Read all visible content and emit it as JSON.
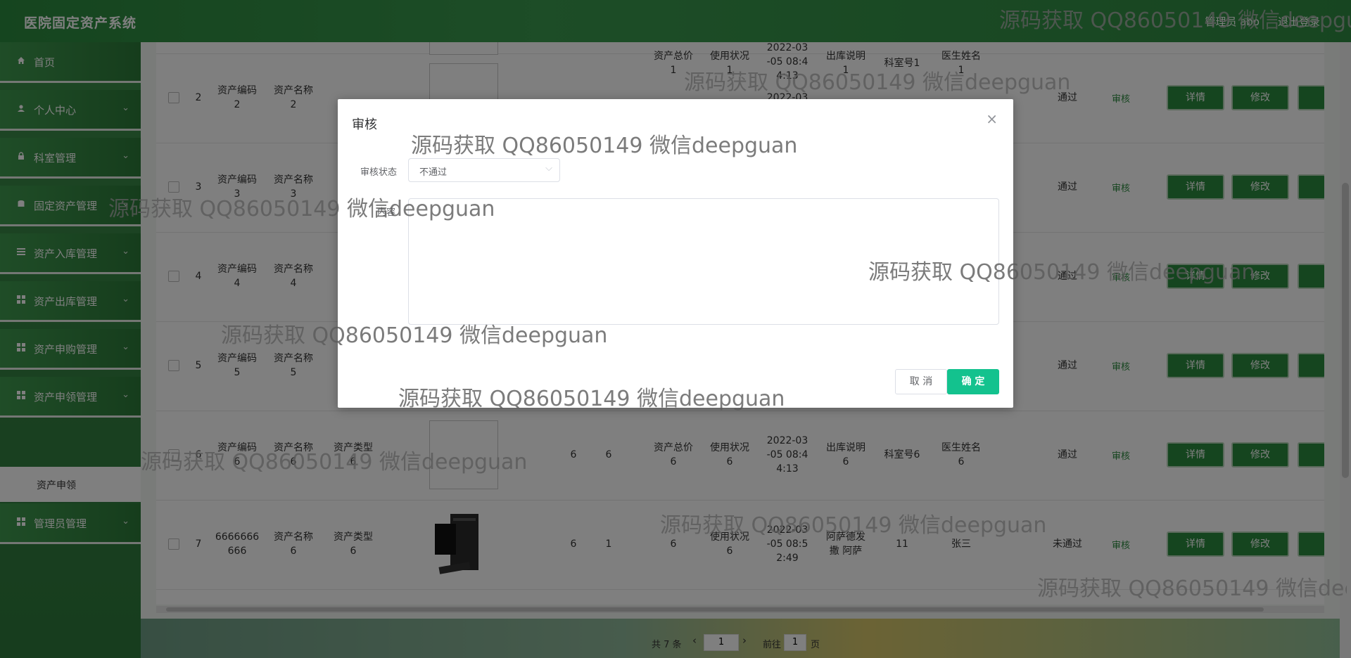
{
  "app": {
    "title": "医院固定资产系统",
    "user": "管理员 abo",
    "logout": "退出登录"
  },
  "sidebar": {
    "items": [
      {
        "label": "首页",
        "icon": "home-icon",
        "chevron": ""
      },
      {
        "label": "个人中心",
        "icon": "user-icon",
        "chevron": "⌄"
      },
      {
        "label": "科室管理",
        "icon": "lock-icon",
        "chevron": "⌄"
      },
      {
        "label": "固定资产管理",
        "icon": "database-icon",
        "chevron": "⌄"
      },
      {
        "label": "资产入库管理",
        "icon": "list-icon",
        "chevron": "⌄"
      },
      {
        "label": "资产出库管理",
        "icon": "grid-icon",
        "chevron": "⌄"
      },
      {
        "label": "资产申购管理",
        "icon": "grid-icon",
        "chevron": "⌄"
      },
      {
        "label": "资产申领管理",
        "icon": "grid-icon",
        "chevron": "⌄"
      },
      {
        "label": "管理员管理",
        "icon": "grid-icon",
        "chevron": "⌄"
      }
    ],
    "sub_item": "资产申领"
  },
  "table": {
    "partial_top_row": {
      "col1": "资产总价\n1",
      "col2": "使用状况\n1",
      "date": "2022-03\n-05 08:4\n4:13",
      "desc": "出库说明\n1",
      "dept": "科室号1",
      "doctor": "医生姓名\n1"
    },
    "rows": [
      {
        "idx": "2",
        "code": "资产编码\n2",
        "name": "资产名称\n2",
        "type": "",
        "qty": "",
        "num": "",
        "total": "",
        "status": "",
        "date": "2022-03",
        "desc": "",
        "dept": "",
        "doctor": "",
        "audit": "通过"
      },
      {
        "idx": "3",
        "code": "资产编码\n3",
        "name": "资产名称\n3",
        "type": "",
        "qty": "",
        "num": "",
        "total": "",
        "status": "",
        "date": "",
        "desc": "",
        "dept": "",
        "doctor": "",
        "audit": "通过"
      },
      {
        "idx": "4",
        "code": "资产编码\n4",
        "name": "资产名称\n4",
        "type": "",
        "qty": "",
        "num": "",
        "total": "",
        "status": "",
        "date": "",
        "desc": "",
        "dept": "",
        "doctor": "",
        "audit": "通过"
      },
      {
        "idx": "5",
        "code": "资产编码\n5",
        "name": "资产名称\n5",
        "type": "",
        "qty": "",
        "num": "",
        "total": "",
        "status": "",
        "date": "",
        "desc": "",
        "dept": "",
        "doctor": "",
        "audit": "通过"
      },
      {
        "idx": "6",
        "code": "资产编码\n6",
        "name": "资产名称\n6",
        "type": "资产类型\n6",
        "qty": "6",
        "num": "6",
        "total": "资产总价\n6",
        "status": "使用状况\n6",
        "date": "2022-03\n-05 08:4\n4:13",
        "desc": "出库说明\n6",
        "dept": "科室号6",
        "doctor": "医生姓名\n6",
        "audit": "通过"
      },
      {
        "idx": "7",
        "code": "6666666\n666",
        "name": "资产名称\n6",
        "type": "资产类型\n6",
        "qty": "6",
        "num": "1",
        "total": "6",
        "status": "使用状况\n6",
        "date": "2022-03\n-05 08:5\n2:49",
        "desc": "阿萨德发\n撒 阿萨",
        "dept": "11",
        "doctor": "张三",
        "audit": "未通过"
      }
    ],
    "audit_link": "审核",
    "btn_detail": "详情",
    "btn_edit": "修改"
  },
  "pager": {
    "total": "共 7 条",
    "page": "1",
    "goto": "前往",
    "goto_page": "1",
    "page_suffix": "页"
  },
  "dialog": {
    "title": "审核",
    "status_label": "审核状态",
    "status_value": "不通过",
    "content_label": "内容",
    "cancel": "取 消",
    "confirm": "确 定"
  },
  "watermark": "源码获取 QQ86050149 微信deepguan"
}
